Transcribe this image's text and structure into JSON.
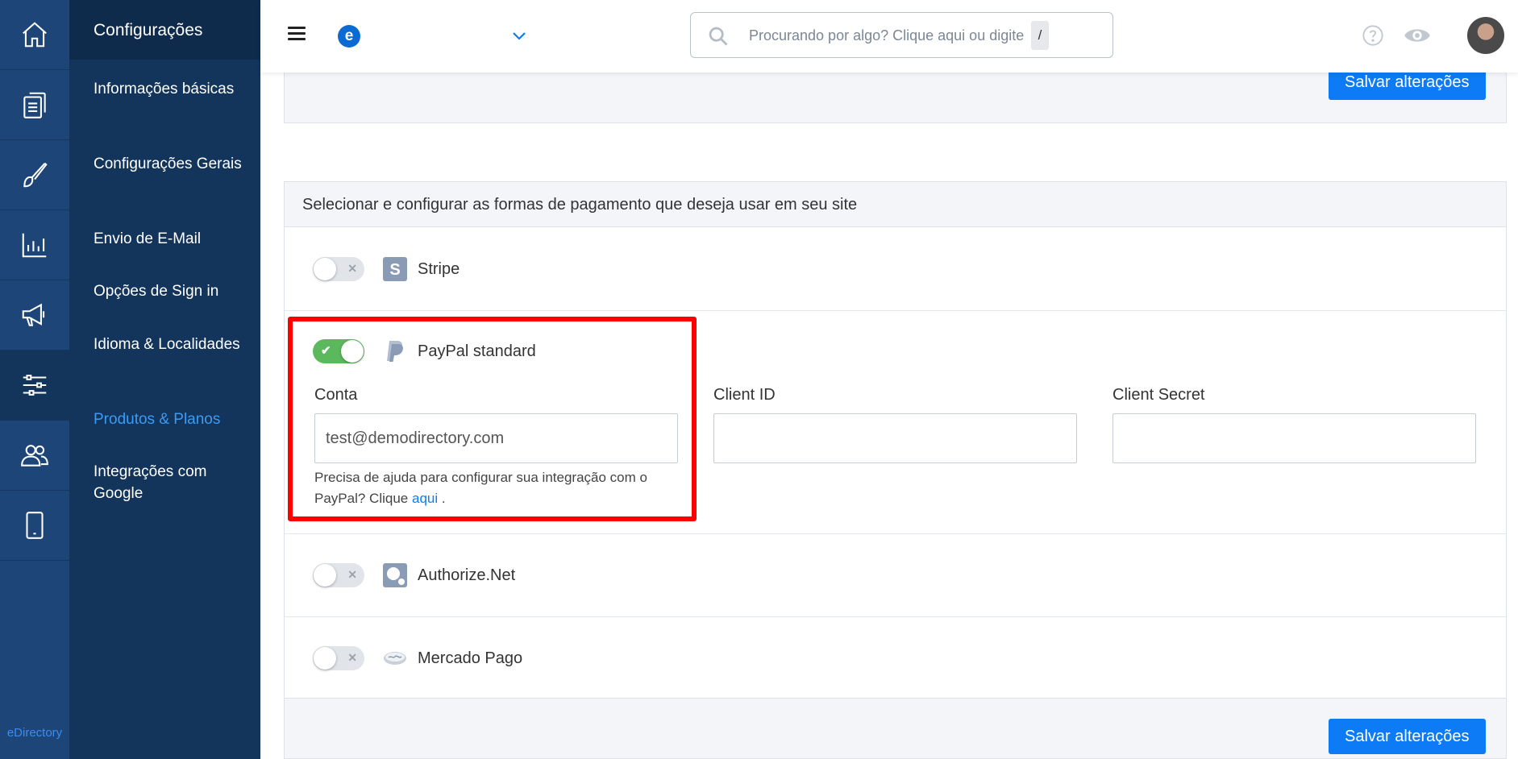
{
  "rail": {
    "items": [
      {
        "icon": "home-icon"
      },
      {
        "icon": "documents-icon"
      },
      {
        "icon": "brush-icon"
      },
      {
        "icon": "chart-icon"
      },
      {
        "icon": "megaphone-icon"
      },
      {
        "icon": "sliders-icon"
      },
      {
        "icon": "users-icon"
      },
      {
        "icon": "mobile-icon"
      }
    ],
    "brand": "eDirectory"
  },
  "subnav": {
    "title": "Configurações",
    "items": [
      {
        "label": "Informações básicas"
      },
      {
        "label": "Configurações Gerais"
      },
      {
        "label": "Envio de E-Mail"
      },
      {
        "label": "Opções de Sign in"
      },
      {
        "label": "Idioma & Localidades"
      },
      {
        "label": "Produtos & Planos"
      },
      {
        "label": "Integrações com Google"
      }
    ]
  },
  "topbar": {
    "site_logo": "e",
    "search": {
      "placeholder": "Procurando por algo? Clique aqui ou digite",
      "shortcut": "/"
    }
  },
  "main": {
    "save_label": "Salvar alterações",
    "payments": {
      "heading": "Selecionar e configurar as formas de pagamento que deseja usar em seu site",
      "gateways": [
        {
          "name": "Stripe",
          "enabled": false
        },
        {
          "name": "PayPal standard",
          "enabled": true
        },
        {
          "name": "Authorize.Net",
          "enabled": false
        },
        {
          "name": "Mercado Pago",
          "enabled": false
        }
      ],
      "paypal": {
        "account_label": "Conta",
        "account_value": "test@demodirectory.com",
        "client_id_label": "Client ID",
        "client_id_value": "",
        "client_secret_label": "Client Secret",
        "client_secret_value": "",
        "help_prefix": "Precisa de ajuda para configurar sua integração com o PayPal? Clique",
        "help_link": "aqui",
        "help_suffix": "."
      }
    }
  },
  "colors": {
    "rail_bg": "#1d4577",
    "subnav_bg": "#13345b",
    "accent": "#0d7bf5",
    "toggle_on": "#5cb85c",
    "highlight": "#ff0000"
  }
}
